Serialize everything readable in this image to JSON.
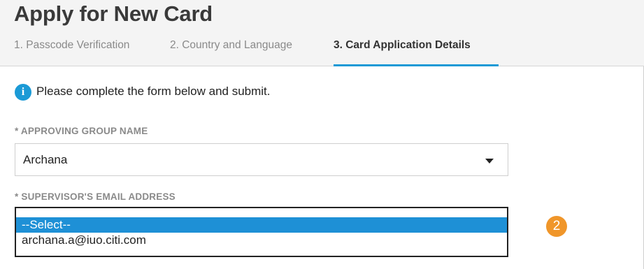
{
  "header": {
    "title": "Apply for New Card",
    "steps": [
      {
        "label": "1. Passcode Verification",
        "active": false
      },
      {
        "label": "2. Country and Language",
        "active": false
      },
      {
        "label": "3. Card Application Details",
        "active": true
      }
    ],
    "accent_color": "#1b9ad6"
  },
  "info": {
    "icon": "info-icon",
    "icon_glyph": "i",
    "text": "Please complete the form below and submit."
  },
  "form": {
    "approving_group": {
      "label": "* APPROVING GROUP NAME",
      "value": "Archana"
    },
    "supervisor_email": {
      "label": "* SUPERVISOR'S EMAIL ADDRESS",
      "options": [
        "--Select--",
        "archana.a@iuo.citi.com"
      ],
      "highlighted_option": "--Select--",
      "highlight_color": "#1e90d6"
    }
  },
  "callout": {
    "number": "2",
    "color": "#f0962a"
  }
}
